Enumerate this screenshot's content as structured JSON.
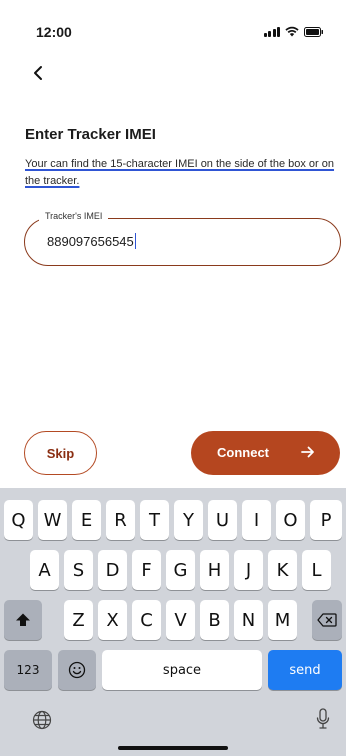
{
  "status_bar": {
    "time": "12:00"
  },
  "screen": {
    "title": "Enter Tracker IMEI",
    "help_text": "Your can find the 15-character IMEI on the side of the box or on the tracker."
  },
  "imei_field": {
    "label": "Tracker's IMEI",
    "value": "889097656545"
  },
  "buttons": {
    "skip": "Skip",
    "connect": "Connect"
  },
  "keyboard": {
    "row1": [
      "Q",
      "W",
      "E",
      "R",
      "T",
      "Y",
      "U",
      "I",
      "O",
      "P"
    ],
    "row2": [
      "A",
      "S",
      "D",
      "F",
      "G",
      "H",
      "J",
      "K",
      "L"
    ],
    "row3": [
      "Z",
      "X",
      "C",
      "V",
      "B",
      "N",
      "M"
    ],
    "numbers_key": "123",
    "space_key": "space",
    "send_key": "send"
  },
  "colors": {
    "accent": "#b5461f",
    "send_blue": "#1e7cf2",
    "underline_blue": "#2f55d4"
  },
  "icons": [
    "back-chevron",
    "signal-bars",
    "wifi",
    "battery",
    "arrow-right",
    "shift",
    "delete",
    "emoji",
    "globe",
    "microphone"
  ]
}
